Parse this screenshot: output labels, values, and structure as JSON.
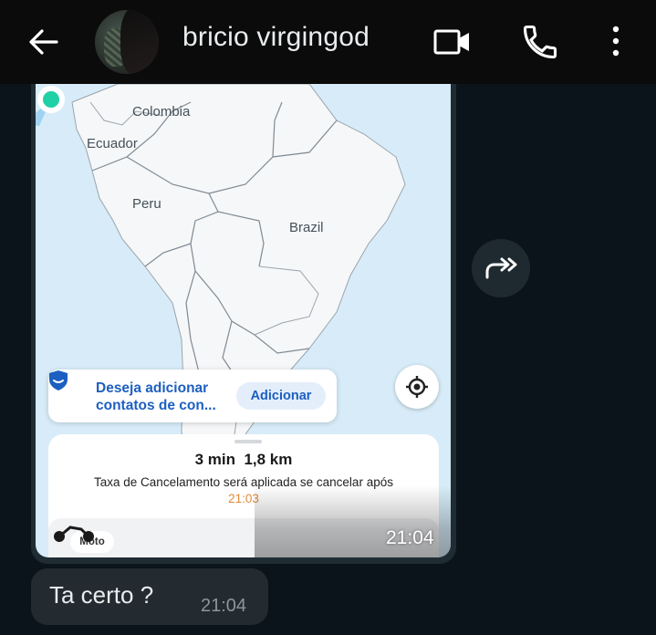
{
  "header": {
    "contact_name": "bricio virgingod",
    "icons": [
      "back-arrow-icon",
      "avatar",
      "video-call-icon",
      "voice-call-icon",
      "more-vert-icon"
    ]
  },
  "image_message": {
    "map": {
      "labels": {
        "colombia": "Colombia",
        "ecuador": "Ecuador",
        "peru": "Peru",
        "brazil": "Brazil"
      }
    },
    "banner": {
      "text_line1": "Deseja adicionar",
      "text_line2": "contatos de con...",
      "button": "Adicionar"
    },
    "sheet": {
      "eta": "3 min  1,8 km",
      "cancel_note": "Taxa de Cancelamento será aplicada se cancelar após",
      "cancel_time": "21:03",
      "vehicle_chip": "Moto"
    },
    "time": "21:04"
  },
  "text_message": {
    "text": "Ta certo ?",
    "time": "21:04"
  },
  "colors": {
    "chat_background": "#0b141a",
    "header_background": "#0b0b0b",
    "bubble_incoming": "#232b30",
    "link_blue": "#1d5fc0",
    "accent_orange": "#e08a3a",
    "pin_teal": "#1fd1a5"
  }
}
